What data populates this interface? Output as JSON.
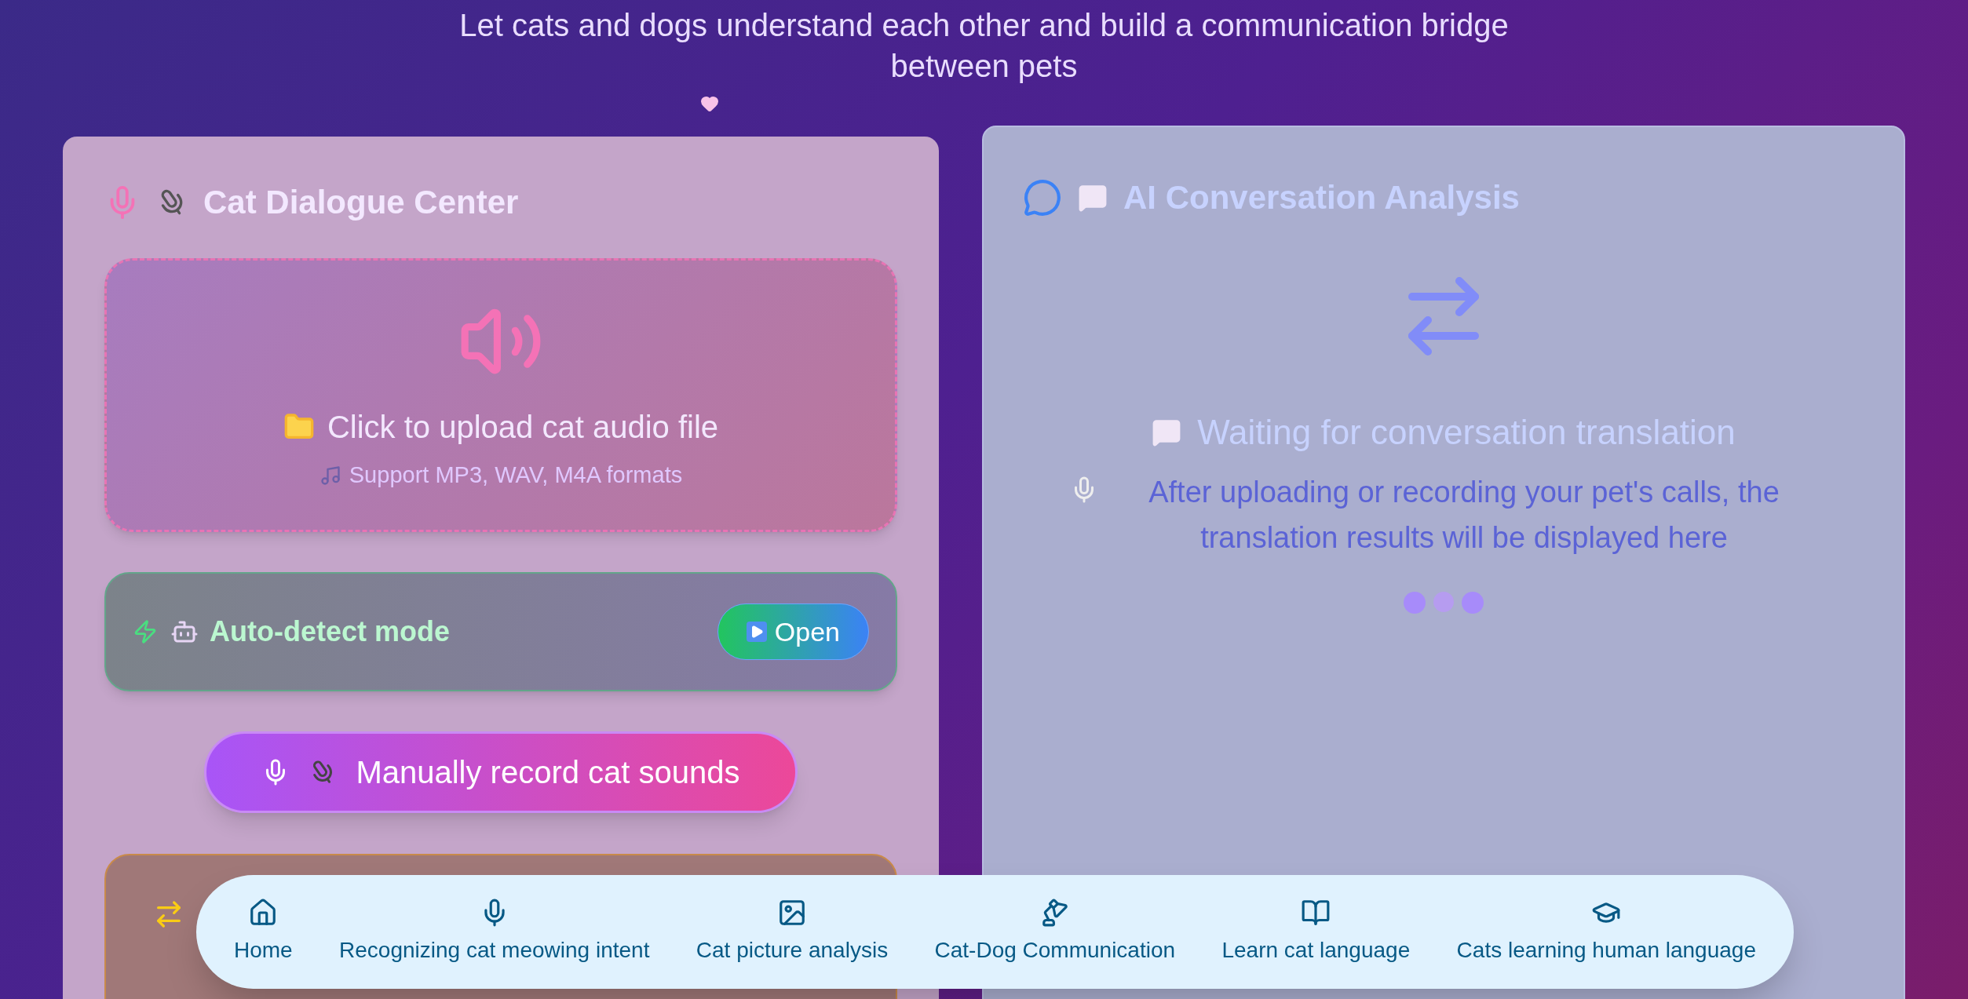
{
  "subtitle": "Let cats and dogs understand each other and build a communication bridge between pets",
  "left_panel": {
    "title": "Cat Dialogue Center",
    "upload": {
      "title": "Click to upload cat audio file",
      "hint": "Support MP3, WAV, M4A formats"
    },
    "auto_detect": {
      "label": "Auto-detect mode",
      "button": "Open"
    },
    "record_button": "Manually record cat sounds"
  },
  "right_panel": {
    "title": "AI Conversation Analysis",
    "status": {
      "title": "Waiting for conversation translation",
      "description": "After uploading or recording your pet's calls, the translation results will be displayed here"
    }
  },
  "nav": [
    {
      "label": "Home"
    },
    {
      "label": "Recognizing cat meowing intent"
    },
    {
      "label": "Cat picture analysis"
    },
    {
      "label": "Cat-Dog Communication"
    },
    {
      "label": "Learn cat language"
    },
    {
      "label": "Cats learning human language"
    }
  ]
}
